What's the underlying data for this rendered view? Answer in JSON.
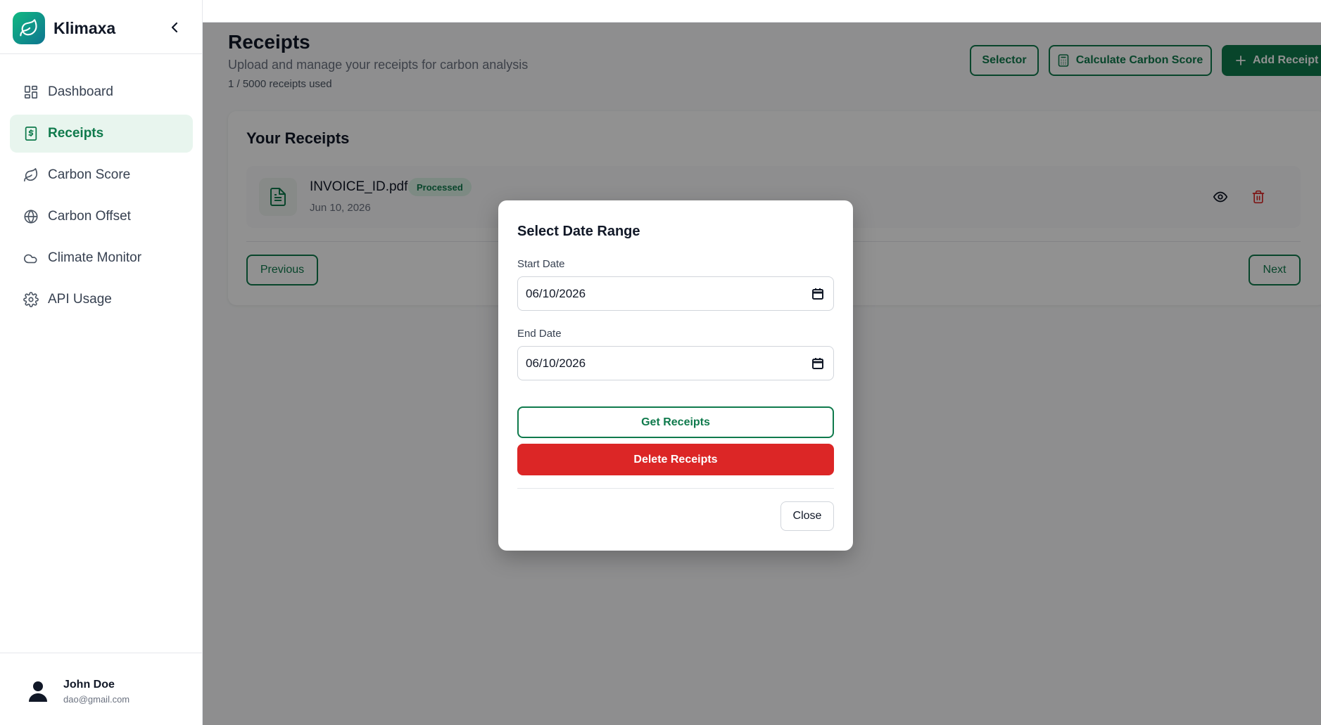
{
  "app": {
    "name": "Klimaxa"
  },
  "sidebar": {
    "items": [
      {
        "label": "Dashboard",
        "icon": "dashboard-grid-icon"
      },
      {
        "label": "Receipts",
        "icon": "receipt-dollar-icon",
        "active": true
      },
      {
        "label": "Carbon Score",
        "icon": "leaf-icon"
      },
      {
        "label": "Carbon Offset",
        "icon": "globe-icon"
      },
      {
        "label": "Climate Monitor",
        "icon": "cloud-icon"
      },
      {
        "label": "API Usage",
        "icon": "gear-icon"
      }
    ]
  },
  "user": {
    "name": "John Doe",
    "email": "dao@gmail.com"
  },
  "header": {
    "title": "Receipts",
    "subtitle": "Upload and manage your receipts for carbon analysis",
    "usage": "1 / 5000 receipts used",
    "selector_label": "Selector",
    "calculate_label": "Calculate Carbon Score",
    "add_label": "Add Receipt"
  },
  "receipts": {
    "title": "Your Receipts",
    "items": [
      {
        "name": "INVOICE_ID.pdf",
        "status": "Processed",
        "date": "Jun 10, 2026"
      }
    ],
    "previous_label": "Previous",
    "next_label": "Next"
  },
  "modal": {
    "title": "Select Date Range",
    "start_label": "Start Date",
    "start_value": "06/10/2026",
    "end_label": "End Date",
    "end_value": "06/10/2026",
    "get_label": "Get Receipts",
    "delete_label": "Delete Receipts",
    "close_label": "Close"
  },
  "colors": {
    "brand": "#0f7a4c",
    "danger": "#dc2626",
    "badge_bg": "#dcf3e6",
    "overlay": "rgba(0,0,0,0.43)"
  }
}
